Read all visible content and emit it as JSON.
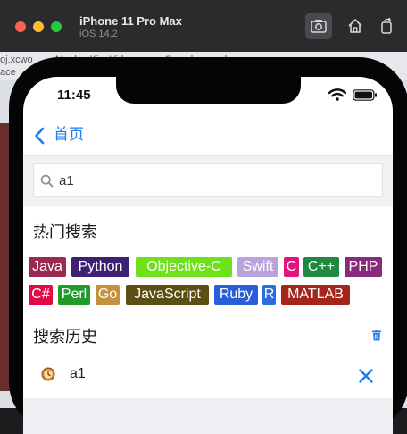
{
  "simulator": {
    "title": "iPhone 11 Pro Max",
    "subtitle": "iOS 14.2",
    "buttons": [
      "screenshot-icon",
      "home-icon",
      "rotate-icon"
    ]
  },
  "background": {
    "tab_text_1": "oj.xcwo",
    "tab_text_2": "MonkeyKingVideo.",
    "tab_text_3": "Search.xcworkspa",
    "tab_text_4": "ace"
  },
  "status_bar": {
    "time": "11:45"
  },
  "nav": {
    "back_label": "首页"
  },
  "search": {
    "value": "a1",
    "placeholder": ""
  },
  "hot": {
    "title": "热门搜索",
    "tags": [
      {
        "label": "Java",
        "color": "#9b2a52"
      },
      {
        "label": "Python",
        "color": "#3f1f74"
      },
      {
        "label": "Objective-C",
        "color": "#6fe11b"
      },
      {
        "label": "Swift",
        "color": "#b9a3dd"
      },
      {
        "label": "C",
        "color": "#e3127d"
      },
      {
        "label": "C++",
        "color": "#1e8a3f"
      },
      {
        "label": "PHP",
        "color": "#8a2a7c"
      },
      {
        "label": "C#",
        "color": "#e10b48"
      },
      {
        "label": "Perl",
        "color": "#1f9a2b"
      },
      {
        "label": "Go",
        "color": "#c4913c"
      },
      {
        "label": "JavaScript",
        "color": "#5c4f12"
      },
      {
        "label": "Ruby",
        "color": "#2a5ed8"
      },
      {
        "label": "R",
        "color": "#2c6de0"
      },
      {
        "label": "MATLAB",
        "color": "#a4261a"
      }
    ]
  },
  "history": {
    "title": "搜索历史",
    "items": [
      {
        "text": "a1"
      }
    ]
  },
  "colors": {
    "accent": "#1e7bf0",
    "search_bg": "#f2f2f4"
  }
}
